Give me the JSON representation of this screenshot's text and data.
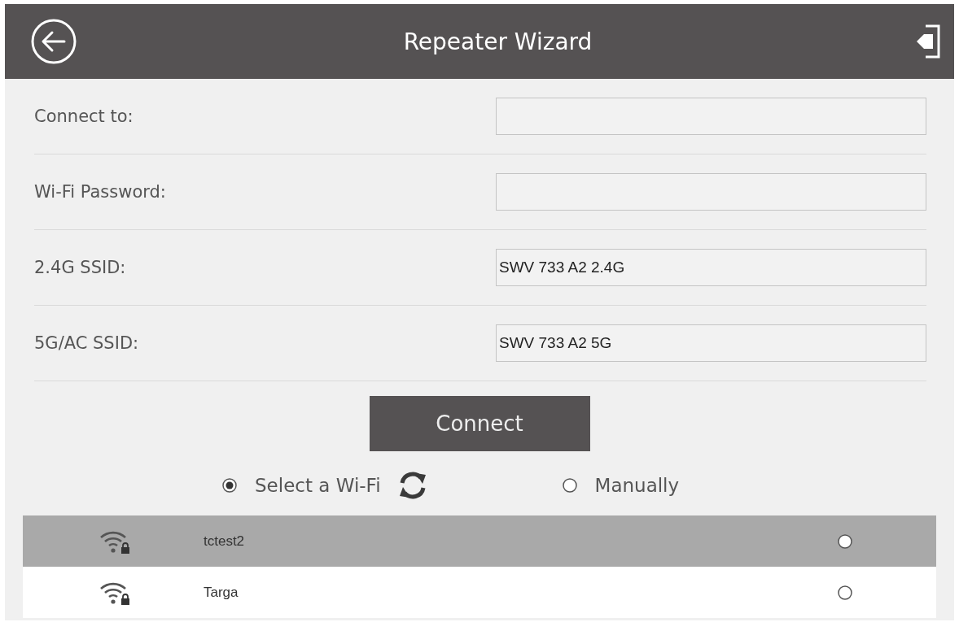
{
  "header": {
    "title": "Repeater Wizard"
  },
  "fields": [
    {
      "label": "Connect to:"
    },
    {
      "label": "Wi-Fi Password:"
    },
    {
      "label": "2.4G SSID:",
      "value": "SWV 733 A2 2.4G"
    },
    {
      "label": "5G/AC SSID:",
      "value": "SWV 733 A2 5G"
    }
  ],
  "connect_button": {
    "label": "Connect"
  },
  "modes": [
    {
      "label": "Select a Wi-Fi",
      "selected": true
    },
    {
      "label": "Manually",
      "selected": false
    }
  ],
  "networks": [
    {
      "name": "tctest2",
      "selected": true,
      "checked": false
    },
    {
      "name": "Targa",
      "selected": false,
      "checked": false
    }
  ]
}
